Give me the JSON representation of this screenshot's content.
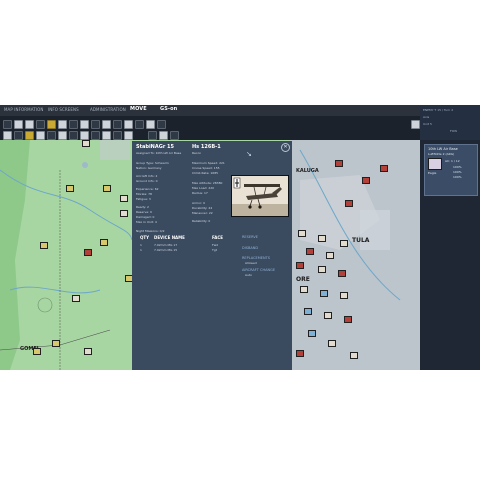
{
  "tabs": [
    {
      "label": "MAP INFORMATION",
      "active": false
    },
    {
      "label": "INFO SCREENS",
      "active": false
    },
    {
      "label": "ADMINISTRATION",
      "active": false
    },
    {
      "label": "MOVE",
      "active": true
    },
    {
      "label": "GS-on",
      "active": true
    }
  ],
  "status": {
    "line1": "ENEMY T 15 / Turn 2",
    "line2": "Axis",
    "line3": "Unit 5",
    "line4": "FOW"
  },
  "map": {
    "towns": [
      {
        "label": "KALUGA"
      },
      {
        "label": "TULA"
      },
      {
        "label": "ORE"
      },
      {
        "label": "GOMEL"
      }
    ]
  },
  "unit_panel": {
    "unit_name": "StabiNAGr 15",
    "unit_sub": "Assigned To: 10th LW Air Base",
    "group_type": "Group Type: Schwarm",
    "nation": "Nation: Germany",
    "aircraft_info": "Aircraft Info: 2",
    "ground_info": "Ground Info: 0",
    "experience": "Experience: 62",
    "morale": "Morale: 78",
    "fatigue": "Fatigue: 3",
    "ready": "Ready: 2",
    "reserve": "Reserve: 0",
    "damaged": "Damaged: 0",
    "max_in_unit": "Max in Unit: 4",
    "night_missions": "Night Missions: 0/2",
    "aircraft_name": "Hs 126B-1",
    "aircraft_role": "Recon",
    "max_speed": "Maximum Speed: 221",
    "cruise_speed": "Cruise Speed: 155",
    "climb_rate": "Climb Rate: 1685",
    "max_alt": "Max Altitude: 28380",
    "max_load": "Max Load: 220",
    "radius": "Radius: 17",
    "armor": "Armor: 0",
    "durability": "Durability: 24",
    "maneuver": "Maneuver: 22",
    "reliability": "Reliability: 0",
    "col_qty": "QTY",
    "col_device": "DEVICE NAME",
    "col_face": "FACE",
    "devices": [
      {
        "qty": "1",
        "name": "7.92mm MG 17",
        "face": "Fwd"
      },
      {
        "qty": "1",
        "name": "7.92mm MG 15",
        "face": "Tgt"
      }
    ],
    "action_reserve": "RESERVE",
    "action_disband": "DISBAND",
    "action_replacements": "REPLACEMENTS",
    "replacements_value": "Allowed",
    "action_aircraft": "AIRCRAFT CHANGE",
    "aircraft_change_value": "Auto",
    "close_glyph": "✕"
  },
  "side_card": {
    "title": "10th LW Air Base",
    "sub": "Luftflotte 2 (ARG)",
    "stat1": "AC: 1 / 12",
    "stat2": "100%",
    "stat3": "100%",
    "stat4": "100%",
    "footer": "Eagle"
  },
  "colors": {
    "panel_bg": "#3a4a5f",
    "map_green": "#a9d7a5",
    "map_grey": "#b9c2cb",
    "toolbar": "#1b222b",
    "accent_blue": "#8fb3d9"
  }
}
